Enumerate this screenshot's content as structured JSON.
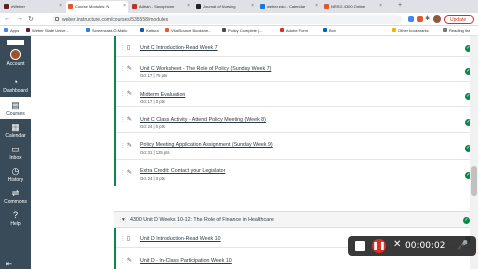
{
  "browser": {
    "tabs": [
      {
        "label": "eWeber",
        "color": "#6a1b2a"
      },
      {
        "label": "Course Modules: N",
        "color": "#e4572e",
        "active": true
      },
      {
        "label": "Adrian - Saxophone",
        "color": "#c4302b"
      },
      {
        "label": "Journal of Nursing",
        "color": "#222222"
      },
      {
        "label": "weber.edu - Calendar",
        "color": "#1a73e8"
      },
      {
        "label": "NRSG 4300 Online",
        "color": "#e4572e"
      }
    ],
    "new_tab": "+",
    "url": "weber.instructure.com/courses/535558/modules",
    "update_label": "Update",
    "bookmarks": [
      {
        "label": "Apps",
        "color": "#4285f4"
      },
      {
        "label": "Weber State Unive...",
        "color": "#6a1b2a"
      },
      {
        "label": "Screencast-O-Matic",
        "color": "#2a84d2"
      },
      {
        "label": "Kaltura",
        "color": "#0b5ea8"
      },
      {
        "label": "VitalSource Bookshe...",
        "color": "#e4572e"
      },
      {
        "label": "Policy Complete |...",
        "color": "#4a4a4a"
      },
      {
        "label": "Adobe Form",
        "color": "#d93025"
      },
      {
        "label": "Box",
        "color": "#0061d5"
      }
    ],
    "other_bookmarks": "Other bookmarks",
    "reading_list": "Reading list"
  },
  "sidebar": {
    "items": [
      {
        "label": "Account",
        "icon": "avatar"
      },
      {
        "label": "Dashboard",
        "icon": "dashboard-icon",
        "glyph": "◔"
      },
      {
        "label": "Courses",
        "icon": "courses-icon",
        "glyph": "▤",
        "active": true
      },
      {
        "label": "Calendar",
        "icon": "calendar-icon",
        "glyph": "▦"
      },
      {
        "label": "Inbox",
        "icon": "inbox-icon",
        "glyph": "▭"
      },
      {
        "label": "History",
        "icon": "history-icon",
        "glyph": "◷"
      },
      {
        "label": "Commons",
        "icon": "commons-icon",
        "glyph": "⇌"
      },
      {
        "label": "Help",
        "icon": "help-icon",
        "glyph": "?"
      }
    ],
    "collapse_glyph": "⇤"
  },
  "module": {
    "items": [
      {
        "title": "Unit C Introduction-Read Week 7",
        "meta": "",
        "icon": "page-icon",
        "glyph": "▯"
      },
      {
        "title": "Unit C Worksheet - The Role of Policy (Sunday Week 7)",
        "meta": "Oct 17  |  75 pts",
        "icon": "assignment-icon",
        "glyph": "✎"
      },
      {
        "title": "Midterm Evaluation",
        "meta": "Oct 17  |  0 pts",
        "icon": "assignment-icon",
        "glyph": "✎"
      },
      {
        "title": "Unit C Class Activity - Attend Policy Meeting (Week 8)",
        "meta": "Oct 24  |  0 pts",
        "icon": "assignment-icon",
        "glyph": "✎"
      },
      {
        "title": "Policy Meeting Application Assignment (Sunday Week 9)",
        "meta": "Oct 31  |  125 pts",
        "icon": "assignment-icon",
        "glyph": "✎"
      },
      {
        "title": "Extra Credit: Contact your Legislator",
        "meta": "Oct 24  |  0 pts",
        "icon": "assignment-icon",
        "glyph": "✎"
      }
    ]
  },
  "next_module": {
    "title": "4300 Unit D Weeks 10-12: The Role of Finance in Healthcare",
    "items": [
      {
        "title": "Unit D Introduction-Read Week 10",
        "icon": "page-icon",
        "glyph": "▯"
      },
      {
        "title": "Unit D - In-Class Participation Week 10",
        "icon": "assignment-icon",
        "glyph": "✎"
      }
    ]
  },
  "recorder": {
    "time": "00:00:02",
    "pause_glyph": "❚❚",
    "close_glyph": "✕",
    "mic_glyph": "🎤"
  },
  "colors": {
    "sidebar": "#394b58",
    "module_border": "#0b874b",
    "complete": "#0b874b",
    "record": "#d93025"
  }
}
